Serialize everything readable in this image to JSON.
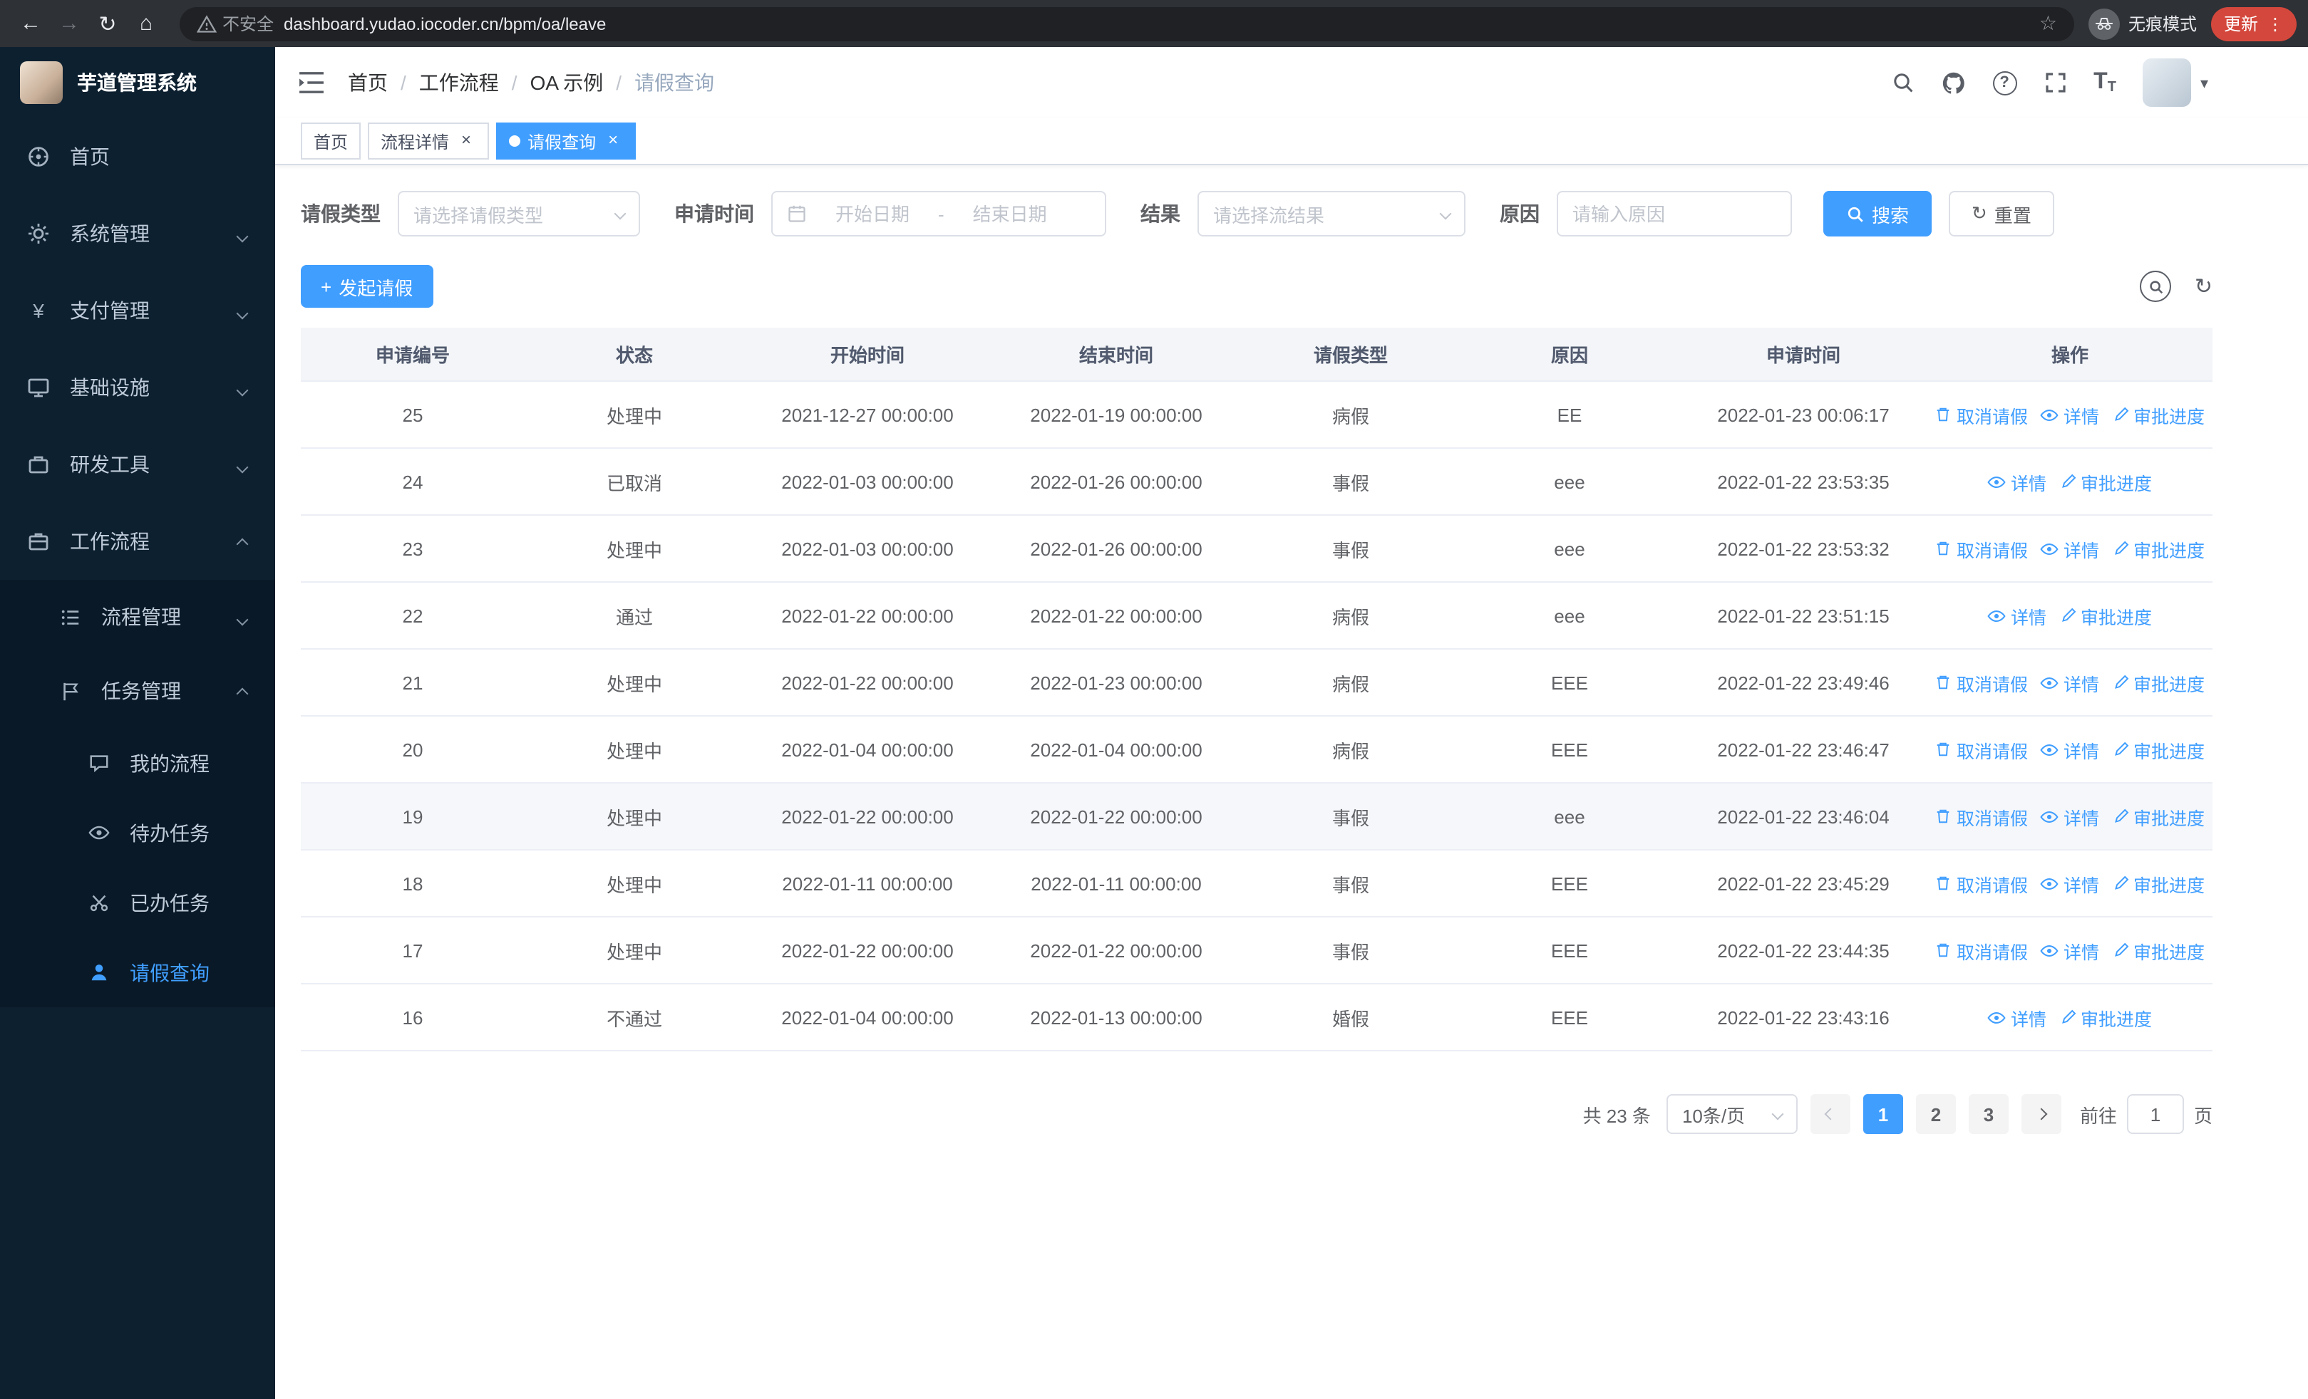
{
  "browser": {
    "security_label": "不安全",
    "url": "dashboard.yudao.iocoder.cn/bpm/oa/leave",
    "incognito_label": "无痕模式",
    "update_label": "更新"
  },
  "icons": {
    "back": "←",
    "forward": "→",
    "reload": "↻",
    "home": "⌂",
    "star": "☆",
    "ellipsis": "⋮",
    "question": "?",
    "font_large": "T",
    "font_small": "T",
    "caret_down": "▾",
    "plus": "+",
    "close": "×",
    "dash": "-",
    "yen": "¥",
    "refresh": "↻"
  },
  "sidebar": {
    "title": "芋道管理系统",
    "items": [
      {
        "label": "首页"
      },
      {
        "label": "系统管理"
      },
      {
        "label": "支付管理"
      },
      {
        "label": "基础设施"
      },
      {
        "label": "研发工具"
      },
      {
        "label": "工作流程"
      }
    ],
    "workflow_children": [
      {
        "label": "流程管理"
      },
      {
        "label": "任务管理"
      }
    ],
    "task_children": [
      {
        "label": "我的流程"
      },
      {
        "label": "待办任务"
      },
      {
        "label": "已办任务"
      },
      {
        "label": "请假查询"
      }
    ]
  },
  "navbar": {
    "breadcrumb": [
      "首页",
      "工作流程",
      "OA 示例",
      "请假查询"
    ]
  },
  "tabs": [
    {
      "label": "首页"
    },
    {
      "label": "流程详情"
    },
    {
      "label": "请假查询"
    }
  ],
  "filters": {
    "leave_type_label": "请假类型",
    "leave_type_placeholder": "请选择请假类型",
    "apply_time_label": "申请时间",
    "start_placeholder": "开始日期",
    "end_placeholder": "结束日期",
    "result_label": "结果",
    "result_placeholder": "请选择流结果",
    "reason_label": "原因",
    "reason_placeholder": "请输入原因",
    "search_label": "搜索",
    "reset_label": "重置"
  },
  "toolbar": {
    "create_label": "发起请假"
  },
  "table": {
    "columns": [
      "申请编号",
      "状态",
      "开始时间",
      "结束时间",
      "请假类型",
      "原因",
      "申请时间",
      "操作"
    ],
    "action_labels": {
      "cancel": "取消请假",
      "detail": "详情",
      "progress": "审批进度"
    },
    "rows": [
      {
        "id": "25",
        "status": "处理中",
        "start": "2021-12-27 00:00:00",
        "end": "2022-01-19 00:00:00",
        "type": "病假",
        "reason": "EE",
        "apply_time": "2022-01-23 00:06:17",
        "can_cancel": true,
        "highlighted": false
      },
      {
        "id": "24",
        "status": "已取消",
        "start": "2022-01-03 00:00:00",
        "end": "2022-01-26 00:00:00",
        "type": "事假",
        "reason": "eee",
        "apply_time": "2022-01-22 23:53:35",
        "can_cancel": false,
        "highlighted": false
      },
      {
        "id": "23",
        "status": "处理中",
        "start": "2022-01-03 00:00:00",
        "end": "2022-01-26 00:00:00",
        "type": "事假",
        "reason": "eee",
        "apply_time": "2022-01-22 23:53:32",
        "can_cancel": true,
        "highlighted": false
      },
      {
        "id": "22",
        "status": "通过",
        "start": "2022-01-22 00:00:00",
        "end": "2022-01-22 00:00:00",
        "type": "病假",
        "reason": "eee",
        "apply_time": "2022-01-22 23:51:15",
        "can_cancel": false,
        "highlighted": false
      },
      {
        "id": "21",
        "status": "处理中",
        "start": "2022-01-22 00:00:00",
        "end": "2022-01-23 00:00:00",
        "type": "病假",
        "reason": "EEE",
        "apply_time": "2022-01-22 23:49:46",
        "can_cancel": true,
        "highlighted": false
      },
      {
        "id": "20",
        "status": "处理中",
        "start": "2022-01-04 00:00:00",
        "end": "2022-01-04 00:00:00",
        "type": "病假",
        "reason": "EEE",
        "apply_time": "2022-01-22 23:46:47",
        "can_cancel": true,
        "highlighted": false
      },
      {
        "id": "19",
        "status": "处理中",
        "start": "2022-01-22 00:00:00",
        "end": "2022-01-22 00:00:00",
        "type": "事假",
        "reason": "eee",
        "apply_time": "2022-01-22 23:46:04",
        "can_cancel": true,
        "highlighted": true
      },
      {
        "id": "18",
        "status": "处理中",
        "start": "2022-01-11 00:00:00",
        "end": "2022-01-11 00:00:00",
        "type": "事假",
        "reason": "EEE",
        "apply_time": "2022-01-22 23:45:29",
        "can_cancel": true,
        "highlighted": false
      },
      {
        "id": "17",
        "status": "处理中",
        "start": "2022-01-22 00:00:00",
        "end": "2022-01-22 00:00:00",
        "type": "事假",
        "reason": "EEE",
        "apply_time": "2022-01-22 23:44:35",
        "can_cancel": true,
        "highlighted": false
      },
      {
        "id": "16",
        "status": "不通过",
        "start": "2022-01-04 00:00:00",
        "end": "2022-01-13 00:00:00",
        "type": "婚假",
        "reason": "EEE",
        "apply_time": "2022-01-22 23:43:16",
        "can_cancel": false,
        "highlighted": false
      }
    ]
  },
  "pagination": {
    "total_label": "共 23 条",
    "page_size_label": "10条/页",
    "pages": [
      "1",
      "2",
      "3"
    ],
    "goto_label": "前往",
    "goto_value": "1",
    "unit_label": "页"
  },
  "colors": {
    "accent": "#409EFF",
    "sidebar_bg": "#0D2030"
  }
}
